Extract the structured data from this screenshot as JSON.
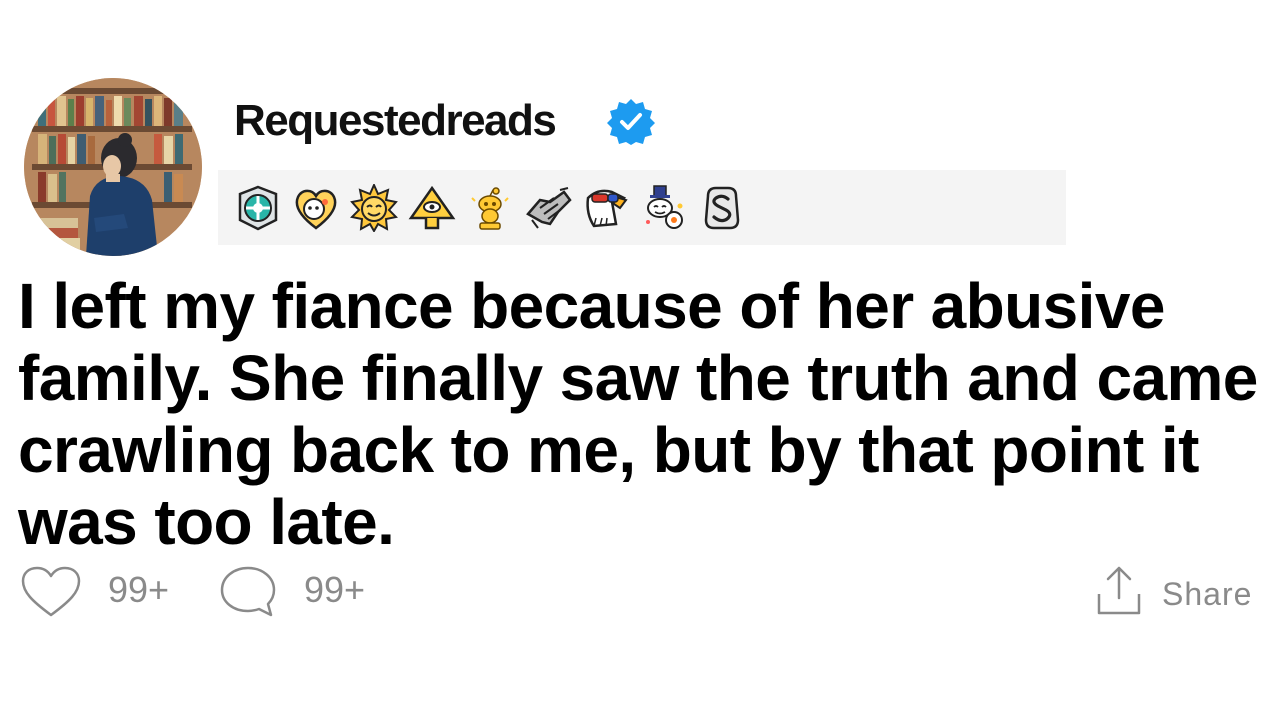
{
  "post": {
    "username": "Requestedreads",
    "title": "I left my fiance because of her abusive family. She finally saw the truth and came crawling back to me, but by that point it was too late."
  },
  "awards": [
    {
      "icon": "platinum-award-icon"
    },
    {
      "icon": "wholesome-heart-award-icon"
    },
    {
      "icon": "sun-award-icon"
    },
    {
      "icon": "pyramid-award-icon"
    },
    {
      "icon": "gold-snoo-award-icon"
    },
    {
      "icon": "handshake-award-icon"
    },
    {
      "icon": "eagle-award-icon"
    },
    {
      "icon": "snoo-party-award-icon"
    },
    {
      "icon": "silver-s-award-icon"
    }
  ],
  "actions": {
    "likes": "99+",
    "comments": "99+",
    "share_label": "Share"
  },
  "colors": {
    "verified": "#1d9bf0",
    "muted": "#8a8a8a",
    "awards_bg": "#f4f4f4"
  }
}
